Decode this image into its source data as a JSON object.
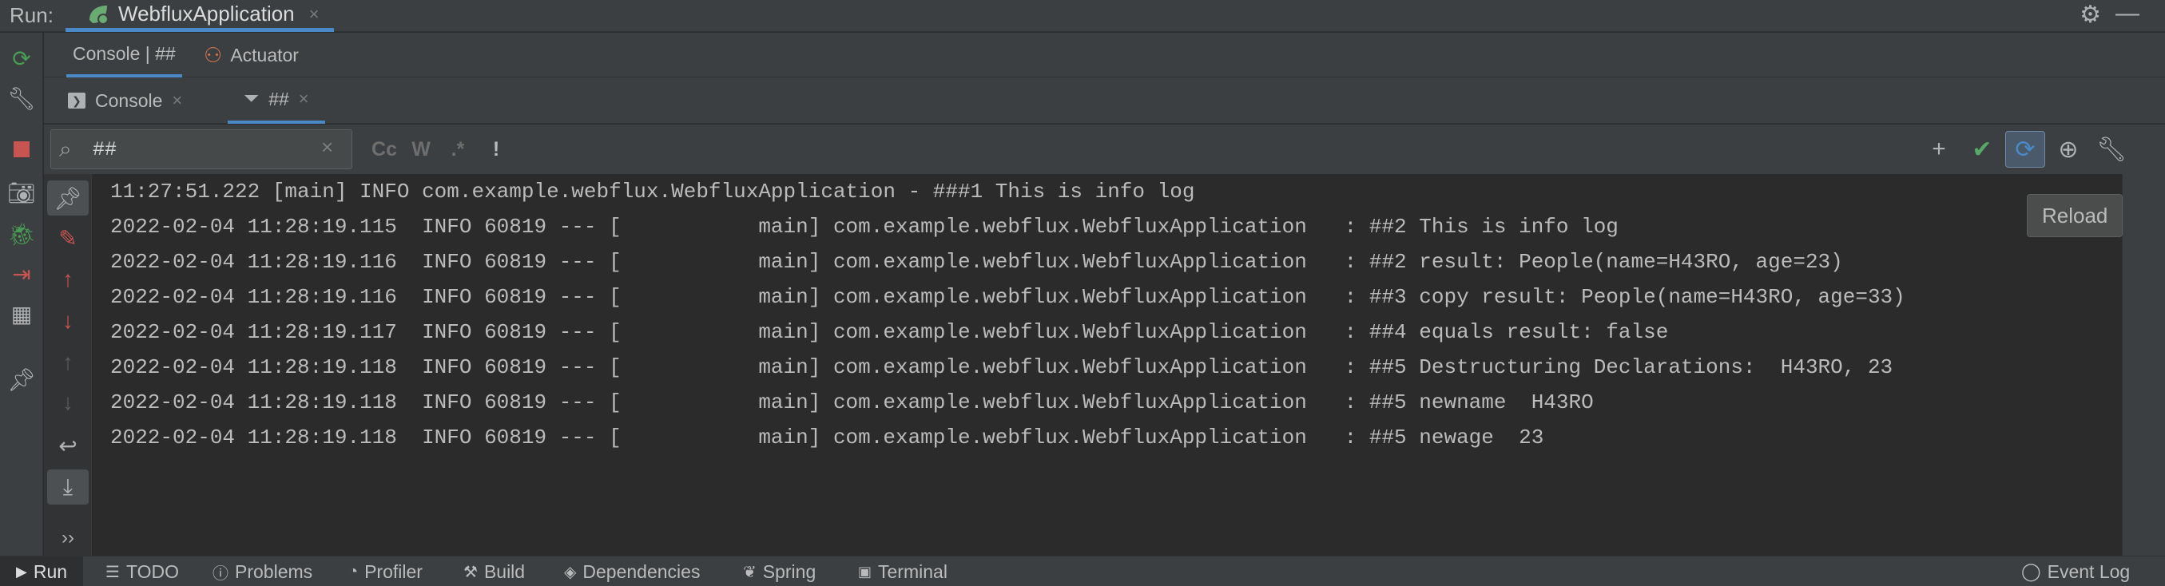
{
  "run_bar": {
    "label": "Run:",
    "tab_title": "WebfluxApplication",
    "tab_close": "×"
  },
  "tool_window": {
    "tabs": [
      {
        "label": "Console | ##"
      },
      {
        "label": "Actuator"
      }
    ]
  },
  "console_tabs": {
    "console_label": "Console",
    "filter_label": "##",
    "close": "×"
  },
  "search": {
    "value": "##",
    "placeholder": "",
    "options": [
      "Cc",
      "W",
      ".*",
      "!"
    ]
  },
  "tooltip": {
    "text": "Reload"
  },
  "log_lines": [
    "11:27:51.222 [main] INFO com.example.webflux.WebfluxApplication - ###1 This is info log",
    "2022-02-04 11:28:19.115  INFO 60819 --- [           main] com.example.webflux.WebfluxApplication   : ##2 This is info log",
    "2022-02-04 11:28:19.116  INFO 60819 --- [           main] com.example.webflux.WebfluxApplication   : ##2 result: People(name=H43RO, age=23)",
    "2022-02-04 11:28:19.116  INFO 60819 --- [           main] com.example.webflux.WebfluxApplication   : ##3 copy result: People(name=H43RO, age=33)",
    "2022-02-04 11:28:19.117  INFO 60819 --- [           main] com.example.webflux.WebfluxApplication   : ##4 equals result: false",
    "2022-02-04 11:28:19.118  INFO 60819 --- [           main] com.example.webflux.WebfluxApplication   : ##5 Destructuring Declarations:  H43RO, 23",
    "2022-02-04 11:28:19.118  INFO 60819 --- [           main] com.example.webflux.WebfluxApplication   : ##5 newname  H43RO",
    "2022-02-04 11:28:19.118  INFO 60819 --- [           main] com.example.webflux.WebfluxApplication   : ##5 newage  23"
  ],
  "bottom_bar": {
    "run": "Run",
    "todo": "TODO",
    "problems": "Problems",
    "profiler": "Profiler",
    "build": "Build",
    "dependencies": "Dependencies",
    "spring": "Spring",
    "terminal": "Terminal",
    "event_log": "Event Log"
  },
  "colors": {
    "accent": "#4a88c7",
    "stop_red": "#c75450",
    "rerun_green": "#499c54",
    "check_green": "#59a869"
  },
  "icons": {
    "gutter_more": "››"
  }
}
